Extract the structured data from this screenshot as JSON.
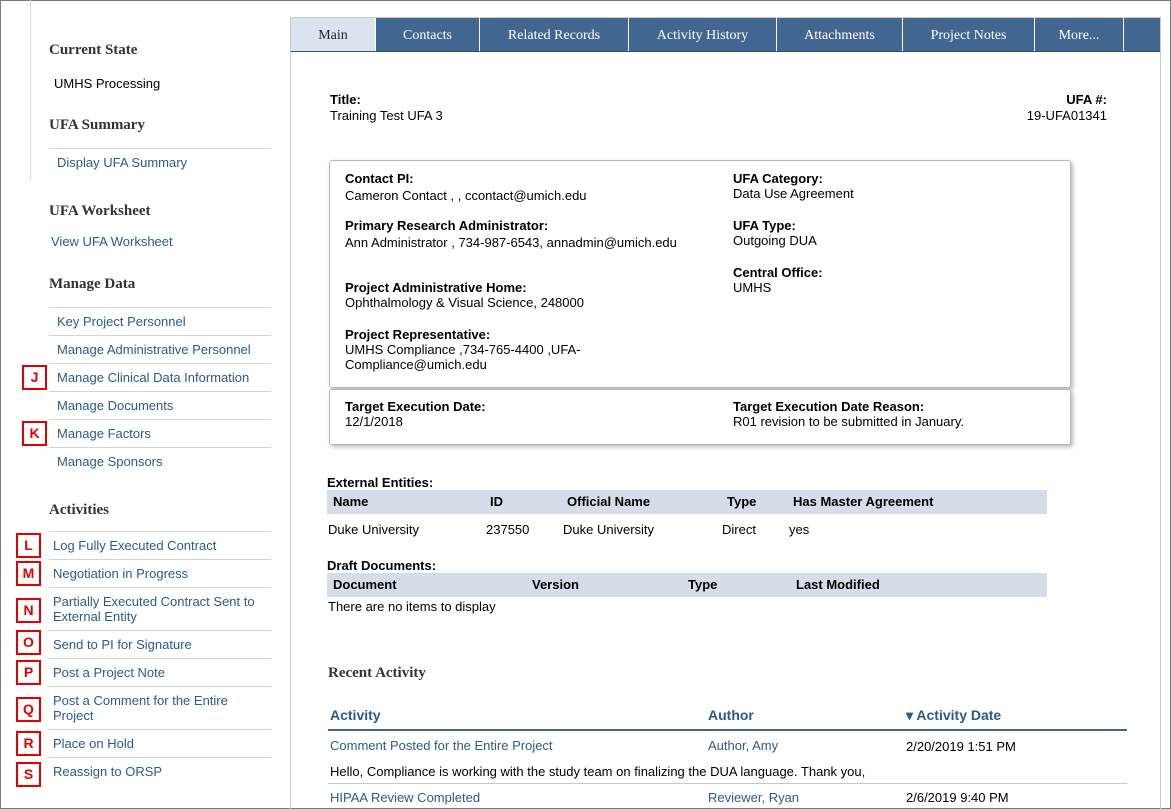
{
  "sidebar": {
    "current_state": {
      "heading": "Current State",
      "value": "UMHS Processing"
    },
    "ufa_summary": {
      "heading": "UFA Summary",
      "link": "Display UFA Summary"
    },
    "ufa_worksheet": {
      "heading": "UFA Worksheet",
      "link": "View UFA Worksheet"
    },
    "manage_data": {
      "heading": "Manage Data",
      "items": [
        "Key Project Personnel",
        "Manage Administrative Personnel",
        "Manage Clinical Data Information",
        "Manage Documents",
        "Manage Factors",
        "Manage Sponsors"
      ]
    },
    "activities": {
      "heading": "Activities",
      "items": [
        "Log Fully Executed Contract",
        "Negotiation in Progress",
        "Partially Executed Contract Sent to External Entity",
        "Send to PI for Signature",
        "Post a Project Note",
        "Post a Comment for the Entire Project",
        "Place on Hold",
        "Reassign to ORSP"
      ]
    }
  },
  "badges": [
    "J",
    "K",
    "L",
    "M",
    "N",
    "O",
    "P",
    "Q",
    "R",
    "S"
  ],
  "tabs": [
    "Main",
    "Contacts",
    "Related Records",
    "Activity History",
    "Attachments",
    "Project Notes",
    "More..."
  ],
  "main": {
    "title_label": "Title:",
    "title_value": "Training Test UFA 3",
    "ufa_label": "UFA #:",
    "ufa_value": "19-UFA01341",
    "contact_pi_label": "Contact PI:",
    "contact_pi_value": "Cameron Contact , , ccontact@umich.edu",
    "pra_label": "Primary Research Administrator:",
    "pra_value": "Ann Administrator , 734-987-6543, annadmin@umich.edu",
    "home_label": "Project Administrative Home:",
    "home_value": "Ophthalmology & Visual Science, 248000",
    "rep_label": "Project Representative:",
    "rep_value_1": "UMHS Compliance ,734-765-4400 ,UFA-",
    "rep_value_2": "Compliance@umich.edu",
    "category_label": "UFA Category:",
    "category_value": "Data Use Agreement",
    "type_label": "UFA Type:",
    "type_value": "Outgoing DUA",
    "central_label": "Central Office:",
    "central_value": "UMHS",
    "target_date_label": "Target Execution Date:",
    "target_date_value": "12/1/2018",
    "target_reason_label": "Target Execution Date Reason:",
    "target_reason_value": "R01 revision to be submitted in January."
  },
  "external_entities": {
    "heading": "External Entities:",
    "columns": [
      "Name",
      "ID",
      "Official Name",
      "Type",
      "Has Master Agreement"
    ],
    "rows": [
      [
        "Duke University",
        "237550",
        "Duke University",
        "Direct",
        "yes"
      ]
    ]
  },
  "draft_documents": {
    "heading": "Draft Documents:",
    "columns": [
      "Document",
      "Version",
      "Type",
      "Last Modified"
    ],
    "empty_text": "There are no items to display"
  },
  "recent_activity": {
    "heading": "Recent Activity",
    "columns": [
      "Activity",
      "Author",
      "Activity Date"
    ],
    "sort_indicator": "▾",
    "rows": [
      {
        "activity": "Comment Posted for the Entire Project",
        "author": "Author, Amy",
        "date": "2/20/2019 1:51 PM",
        "comment": "Hello, Compliance is working with the study team on finalizing the DUA language. Thank you,"
      },
      {
        "activity": "HIPAA Review Completed",
        "author": "Reviewer, Ryan",
        "date": "2/6/2019 9:40 PM"
      }
    ]
  }
}
